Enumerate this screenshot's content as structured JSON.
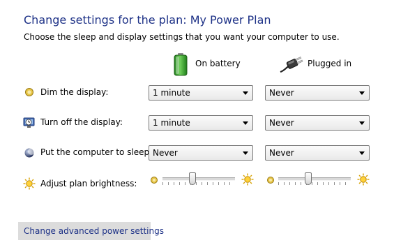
{
  "header": {
    "title": "Change settings for the plan: My Power Plan",
    "subtitle": "Choose the sleep and display settings that you want your computer to use."
  },
  "columns": {
    "battery": {
      "label": "On battery",
      "icon": "battery-icon"
    },
    "plugged": {
      "label": "Plugged in",
      "icon": "power-plug-icon"
    }
  },
  "rows": {
    "dim_display": {
      "label": "Dim the display:",
      "icon": "dim-display-icon",
      "battery_value": "1 minute",
      "plugged_value": "Never"
    },
    "turn_off_display": {
      "label": "Turn off the display:",
      "icon": "monitor-clock-icon",
      "battery_value": "1 minute",
      "plugged_value": "Never"
    },
    "sleep": {
      "label": "Put the computer to sleep:",
      "icon": "moon-icon",
      "battery_value": "Never",
      "plugged_value": "Never"
    },
    "brightness": {
      "label": "Adjust plan brightness:",
      "icon": "brightness-icon",
      "battery_level_percent": 40,
      "plugged_level_percent": 40
    }
  },
  "footer": {
    "advanced_link": "Change advanced power settings"
  },
  "colors": {
    "title": "#1e3287",
    "link": "#1e3287",
    "battery_green": "#3aa62a",
    "button_bg": "#dcdcdc"
  }
}
